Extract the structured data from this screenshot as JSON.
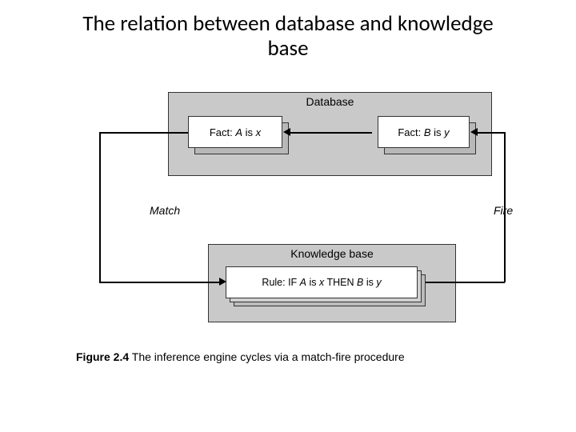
{
  "title_line1": "The relation between database and knowledge",
  "title_line2": "base",
  "database": {
    "label": "Database",
    "fact_a_prefix": "Fact: ",
    "fact_a_var": "A",
    "fact_a_mid": " is ",
    "fact_a_val": "x",
    "fact_b_prefix": "Fact: ",
    "fact_b_var": "B",
    "fact_b_mid": " is ",
    "fact_b_val": "y"
  },
  "knowledge_base": {
    "label": "Knowledge base",
    "rule_prefix": "Rule: IF ",
    "rule_a": "A",
    "rule_mid1": " is ",
    "rule_x": "x",
    "rule_then": " THEN ",
    "rule_b": "B",
    "rule_mid2": " is ",
    "rule_y": "y"
  },
  "arrows": {
    "match": "Match",
    "fire": "Fire"
  },
  "caption": {
    "fig": "Figure 2.4",
    "text": "   The inference engine cycles via a match-fire procedure"
  }
}
